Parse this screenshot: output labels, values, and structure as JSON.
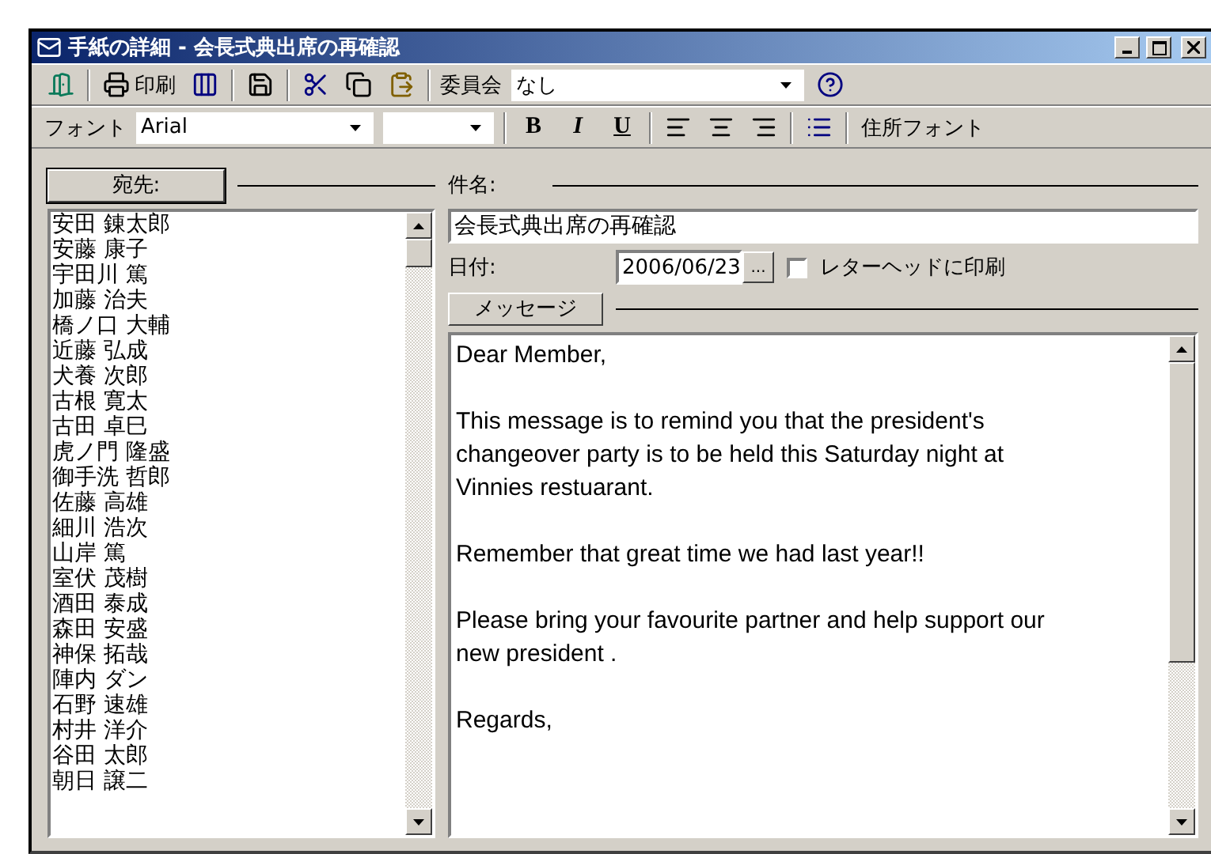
{
  "window": {
    "title": "手紙の詳細 - 会長式典出席の再確認"
  },
  "toolbar": {
    "print_label": "印刷",
    "committee_label": "委員会",
    "committee_value": "なし"
  },
  "format_bar": {
    "font_label": "フォント",
    "font_value": "Arial",
    "bold": "B",
    "italic": "I",
    "underline": "U",
    "address_font": "住所フォント"
  },
  "recipients": {
    "button": "宛先:",
    "names": [
      "安田 錬太郎",
      "安藤 康子",
      "宇田川 篤",
      "加藤 治夫",
      "橋ノ口 大輔",
      "近藤 弘成",
      "犬養 次郎",
      "古根 寛太",
      "古田 卓巳",
      "虎ノ門 隆盛",
      "御手洗 哲郎",
      "佐藤 高雄",
      "細川 浩次",
      "山岸 篤",
      "室伏 茂樹",
      "酒田 泰成",
      "森田 安盛",
      "神保 拓哉",
      "陣内 ダン",
      "石野 速雄",
      "村井 洋介",
      "谷田 太郎",
      "朝日 譲二"
    ]
  },
  "subject": {
    "label": "件名:",
    "value": "会長式典出席の再確認"
  },
  "date": {
    "label": "日付:",
    "value": "2006/06/23",
    "picker": "...",
    "letterhead_label": "レターヘッドに印刷",
    "letterhead_checked": false
  },
  "message": {
    "button": "メッセージ",
    "paragraphs": [
      [
        "Dear Member,"
      ],
      [
        "This message is to remind you that the president's",
        "changeover party is to be held this Saturday night at",
        "Vinnies restuarant."
      ],
      [
        "Remember that great time we had last year!!"
      ],
      [
        "Please bring your favourite partner and help support our",
        "new president ."
      ],
      [
        "Regards,"
      ]
    ]
  }
}
